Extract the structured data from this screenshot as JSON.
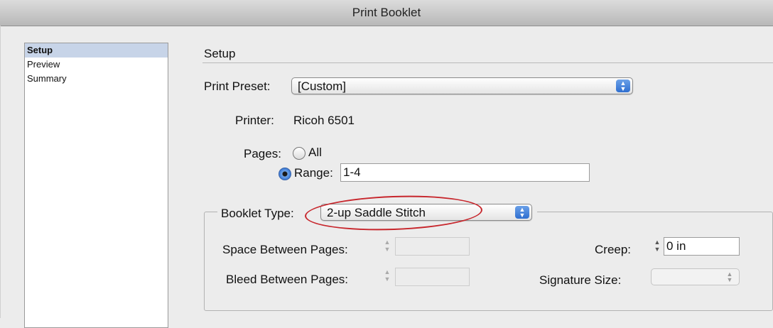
{
  "window": {
    "title": "Print Booklet"
  },
  "sidebar": {
    "items": [
      {
        "label": "Setup",
        "selected": true
      },
      {
        "label": "Preview",
        "selected": false
      },
      {
        "label": "Summary",
        "selected": false
      }
    ]
  },
  "section": {
    "heading": "Setup"
  },
  "print_preset": {
    "label": "Print Preset:",
    "value": "[Custom]"
  },
  "printer": {
    "label": "Printer:",
    "value": "Ricoh 6501"
  },
  "pages": {
    "label": "Pages:",
    "option_all": "All",
    "option_range": "Range:",
    "selected": "range",
    "range_value": "1-4"
  },
  "booklet": {
    "group_label": "Booklet Type:",
    "type_value": "2-up Saddle Stitch",
    "space_between_pages_label": "Space Between Pages:",
    "space_between_pages_value": "",
    "bleed_between_pages_label": "Bleed Between Pages:",
    "bleed_between_pages_value": "",
    "creep_label": "Creep:",
    "creep_value": "0 in",
    "signature_size_label": "Signature Size:",
    "signature_size_value": ""
  },
  "colors": {
    "annotation_ellipse": "#c7262c",
    "selection": "#c7d4e8",
    "accent_blue": "#2f6fd0"
  }
}
